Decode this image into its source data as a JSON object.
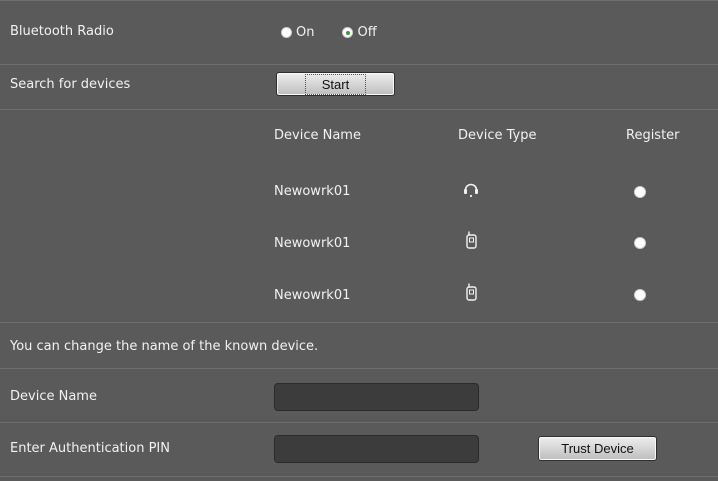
{
  "bluetooth": {
    "label": "Bluetooth Radio",
    "options": [
      {
        "label": "On",
        "checked": false
      },
      {
        "label": "Off",
        "checked": true
      }
    ]
  },
  "search": {
    "label": "Search for devices",
    "start_button": "Start"
  },
  "devices": {
    "headers": [
      "Device Name",
      "Device Type",
      "Register"
    ],
    "rows": [
      {
        "name": "Newowrk01",
        "type_icon": "headset-icon",
        "registered": false
      },
      {
        "name": "Newowrk01",
        "type_icon": "handset-icon",
        "registered": false
      },
      {
        "name": "Newowrk01",
        "type_icon": "handset-icon",
        "registered": false
      }
    ]
  },
  "rename": {
    "info": "You can change the name of the known device.",
    "device_name_label": "Device Name",
    "device_name_value": "",
    "pin_label": "Enter Authentication PIN",
    "pin_value": "",
    "trust_button": "Trust Device"
  }
}
